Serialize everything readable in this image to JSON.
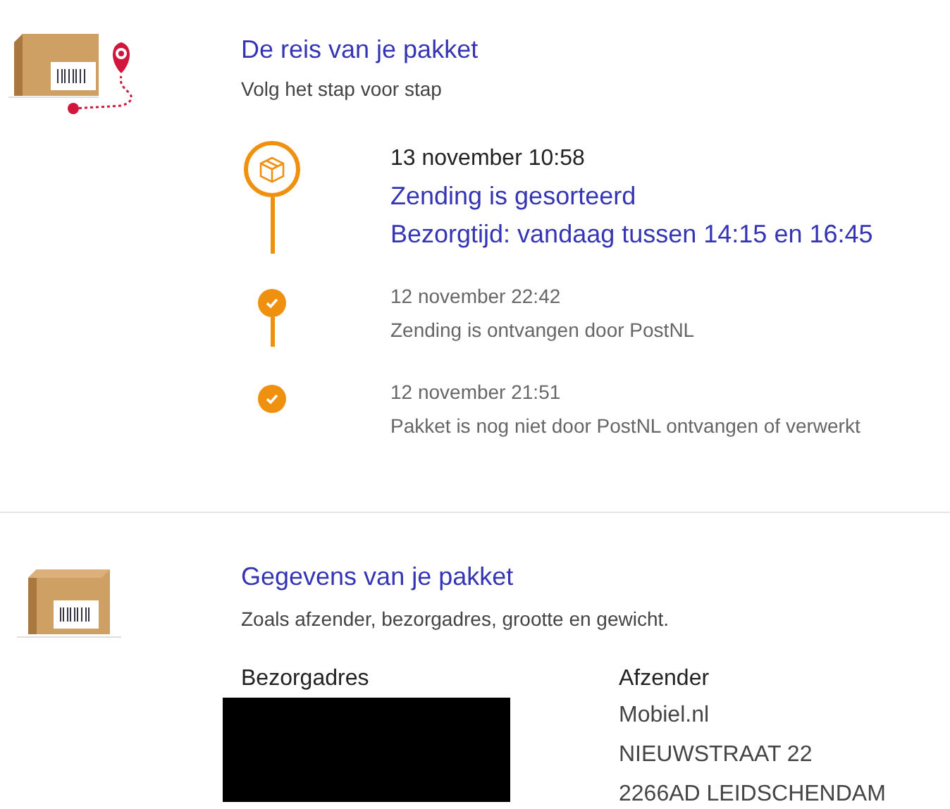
{
  "journey": {
    "title": "De reis van je pakket",
    "subtitle": "Volg het stap voor stap",
    "events": [
      {
        "kind": "current",
        "time": "13 november 10:58",
        "lines": [
          "Zending is gesorteerd",
          "Bezorgtijd: vandaag tussen 14:15 en 16:45"
        ]
      },
      {
        "kind": "done",
        "time": "12 november 22:42",
        "lines": [
          "Zending is ontvangen door PostNL"
        ]
      },
      {
        "kind": "done",
        "time": "12 november 21:51",
        "lines": [
          "Pakket is nog niet door PostNL ontvangen of verwerkt"
        ]
      }
    ]
  },
  "details": {
    "title": "Gegevens van je pakket",
    "subtitle": "Zoals afzender, bezorgadres, grootte en gewicht.",
    "delivery_address": {
      "label": "Bezorgadres"
    },
    "sender": {
      "label": "Afzender",
      "lines": [
        "Mobiel.nl",
        "NIEUWSTRAAT 22",
        "2266AD LEIDSCHENDAM"
      ]
    }
  }
}
